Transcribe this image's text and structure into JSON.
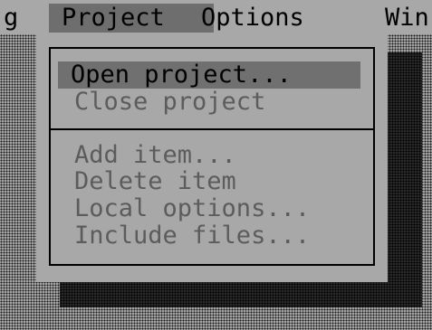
{
  "menubar": {
    "items": [
      {
        "label": "g"
      },
      {
        "label": "Project",
        "active": true
      },
      {
        "label": "Options"
      },
      {
        "label": "Win"
      }
    ]
  },
  "dropdown": {
    "groups": [
      {
        "items": [
          {
            "label": "Open project...",
            "selected": true
          },
          {
            "label": "Close project",
            "disabled": true
          }
        ]
      },
      {
        "items": [
          {
            "label": "Add item...",
            "disabled": true
          },
          {
            "label": "Delete item",
            "disabled": true
          },
          {
            "label": "Local options...",
            "disabled": true
          },
          {
            "label": "Include files...",
            "disabled": true
          }
        ]
      }
    ]
  },
  "colors": {
    "background": "#a8a8a8",
    "highlight": "#707070",
    "text": "#000000",
    "disabled_text": "#5c5c5c"
  }
}
